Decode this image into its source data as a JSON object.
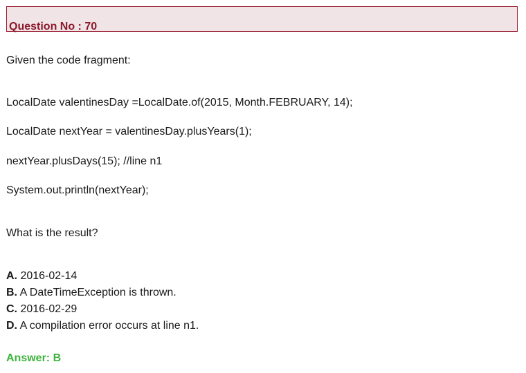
{
  "question": {
    "header": "Question No : 70",
    "intro": "Given the code fragment:",
    "code_lines": [
      "LocalDate valentinesDay =LocalDate.of(2015, Month.FEBRUARY, 14);",
      "LocalDate nextYear = valentinesDay.plusYears(1);",
      "nextYear.plusDays(15); //line n1",
      "System.out.println(nextYear);"
    ],
    "prompt": "What is the result?",
    "options": [
      {
        "letter": "A.",
        "text": "2016-02-14"
      },
      {
        "letter": "B.",
        "text": "A DateTimeException is thrown."
      },
      {
        "letter": "C.",
        "text": "2016-02-29"
      },
      {
        "letter": "D.",
        "text": "A compilation error occurs at line n1."
      }
    ],
    "answer": "Answer: B"
  },
  "colors": {
    "header_border": "#9b1c32",
    "header_fill": "#f0e4e7",
    "header_text": "#8b1a2b",
    "answer_text": "#3cb43c"
  }
}
